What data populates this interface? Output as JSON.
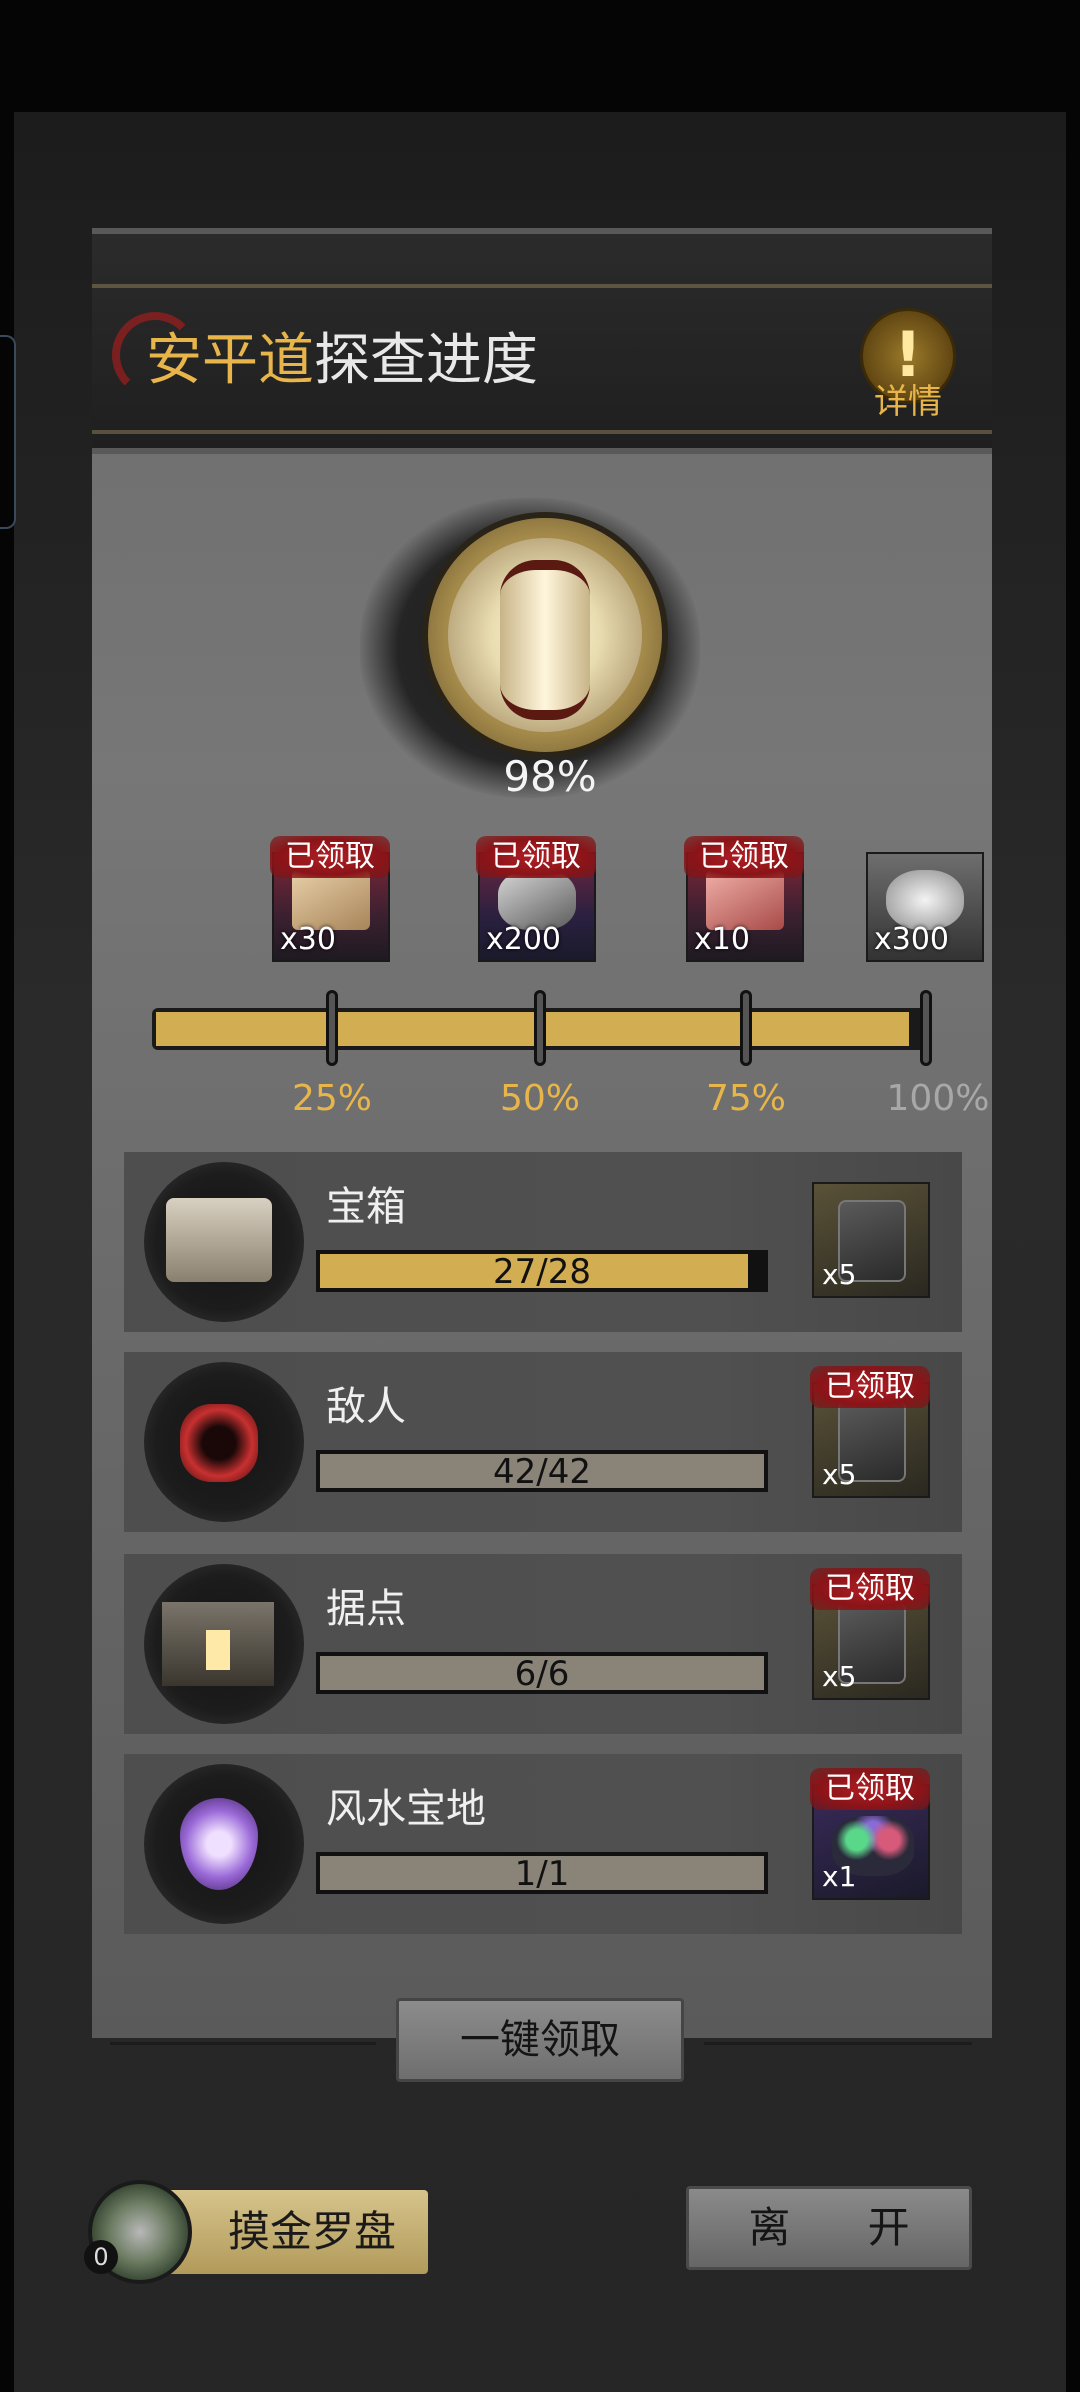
{
  "header": {
    "title_highlight": "安平道",
    "title_rest": "探查进度",
    "details_label": "详情",
    "details_icon": "!"
  },
  "overall": {
    "percent_text": "98%",
    "fraction": 0.98
  },
  "milestones": [
    {
      "label": "25%",
      "qty": "x30",
      "claimed_label": "已领取",
      "claimed": true,
      "item_icon": "scroll-icon"
    },
    {
      "label": "50%",
      "qty": "x200",
      "claimed_label": "已领取",
      "claimed": true,
      "item_icon": "ore-icon"
    },
    {
      "label": "75%",
      "qty": "x10",
      "claimed_label": "已领取",
      "claimed": true,
      "item_icon": "red-scroll-icon"
    },
    {
      "label": "100%",
      "qty": "x300",
      "claimed_label": "",
      "claimed": false,
      "item_icon": "silver-ingot-icon"
    }
  ],
  "tasks": [
    {
      "name": "宝箱",
      "progress": "27/28",
      "current": 27,
      "total": 28,
      "reward_qty": "x5",
      "claimed": false,
      "claimed_label": "",
      "icon": "treasure-chest-icon"
    },
    {
      "name": "敌人",
      "progress": "42/42",
      "current": 42,
      "total": 42,
      "reward_qty": "x5",
      "claimed": true,
      "claimed_label": "已领取",
      "icon": "enemy-skull-icon"
    },
    {
      "name": "据点",
      "progress": "6/6",
      "current": 6,
      "total": 6,
      "reward_qty": "x5",
      "claimed": true,
      "claimed_label": "已领取",
      "icon": "stronghold-icon"
    },
    {
      "name": "风水宝地",
      "progress": "1/1",
      "current": 1,
      "total": 1,
      "reward_qty": "x1",
      "claimed": true,
      "claimed_label": "已领取",
      "icon": "fengshui-icon"
    }
  ],
  "actions": {
    "collect_all": "一键领取",
    "compass_label": "摸金罗盘",
    "compass_count": "0",
    "leave": "离 开"
  },
  "colors": {
    "accent_gold": "#e7b54a",
    "bar_gold": "#d3ad52",
    "claimed_red": "#b01e24"
  }
}
